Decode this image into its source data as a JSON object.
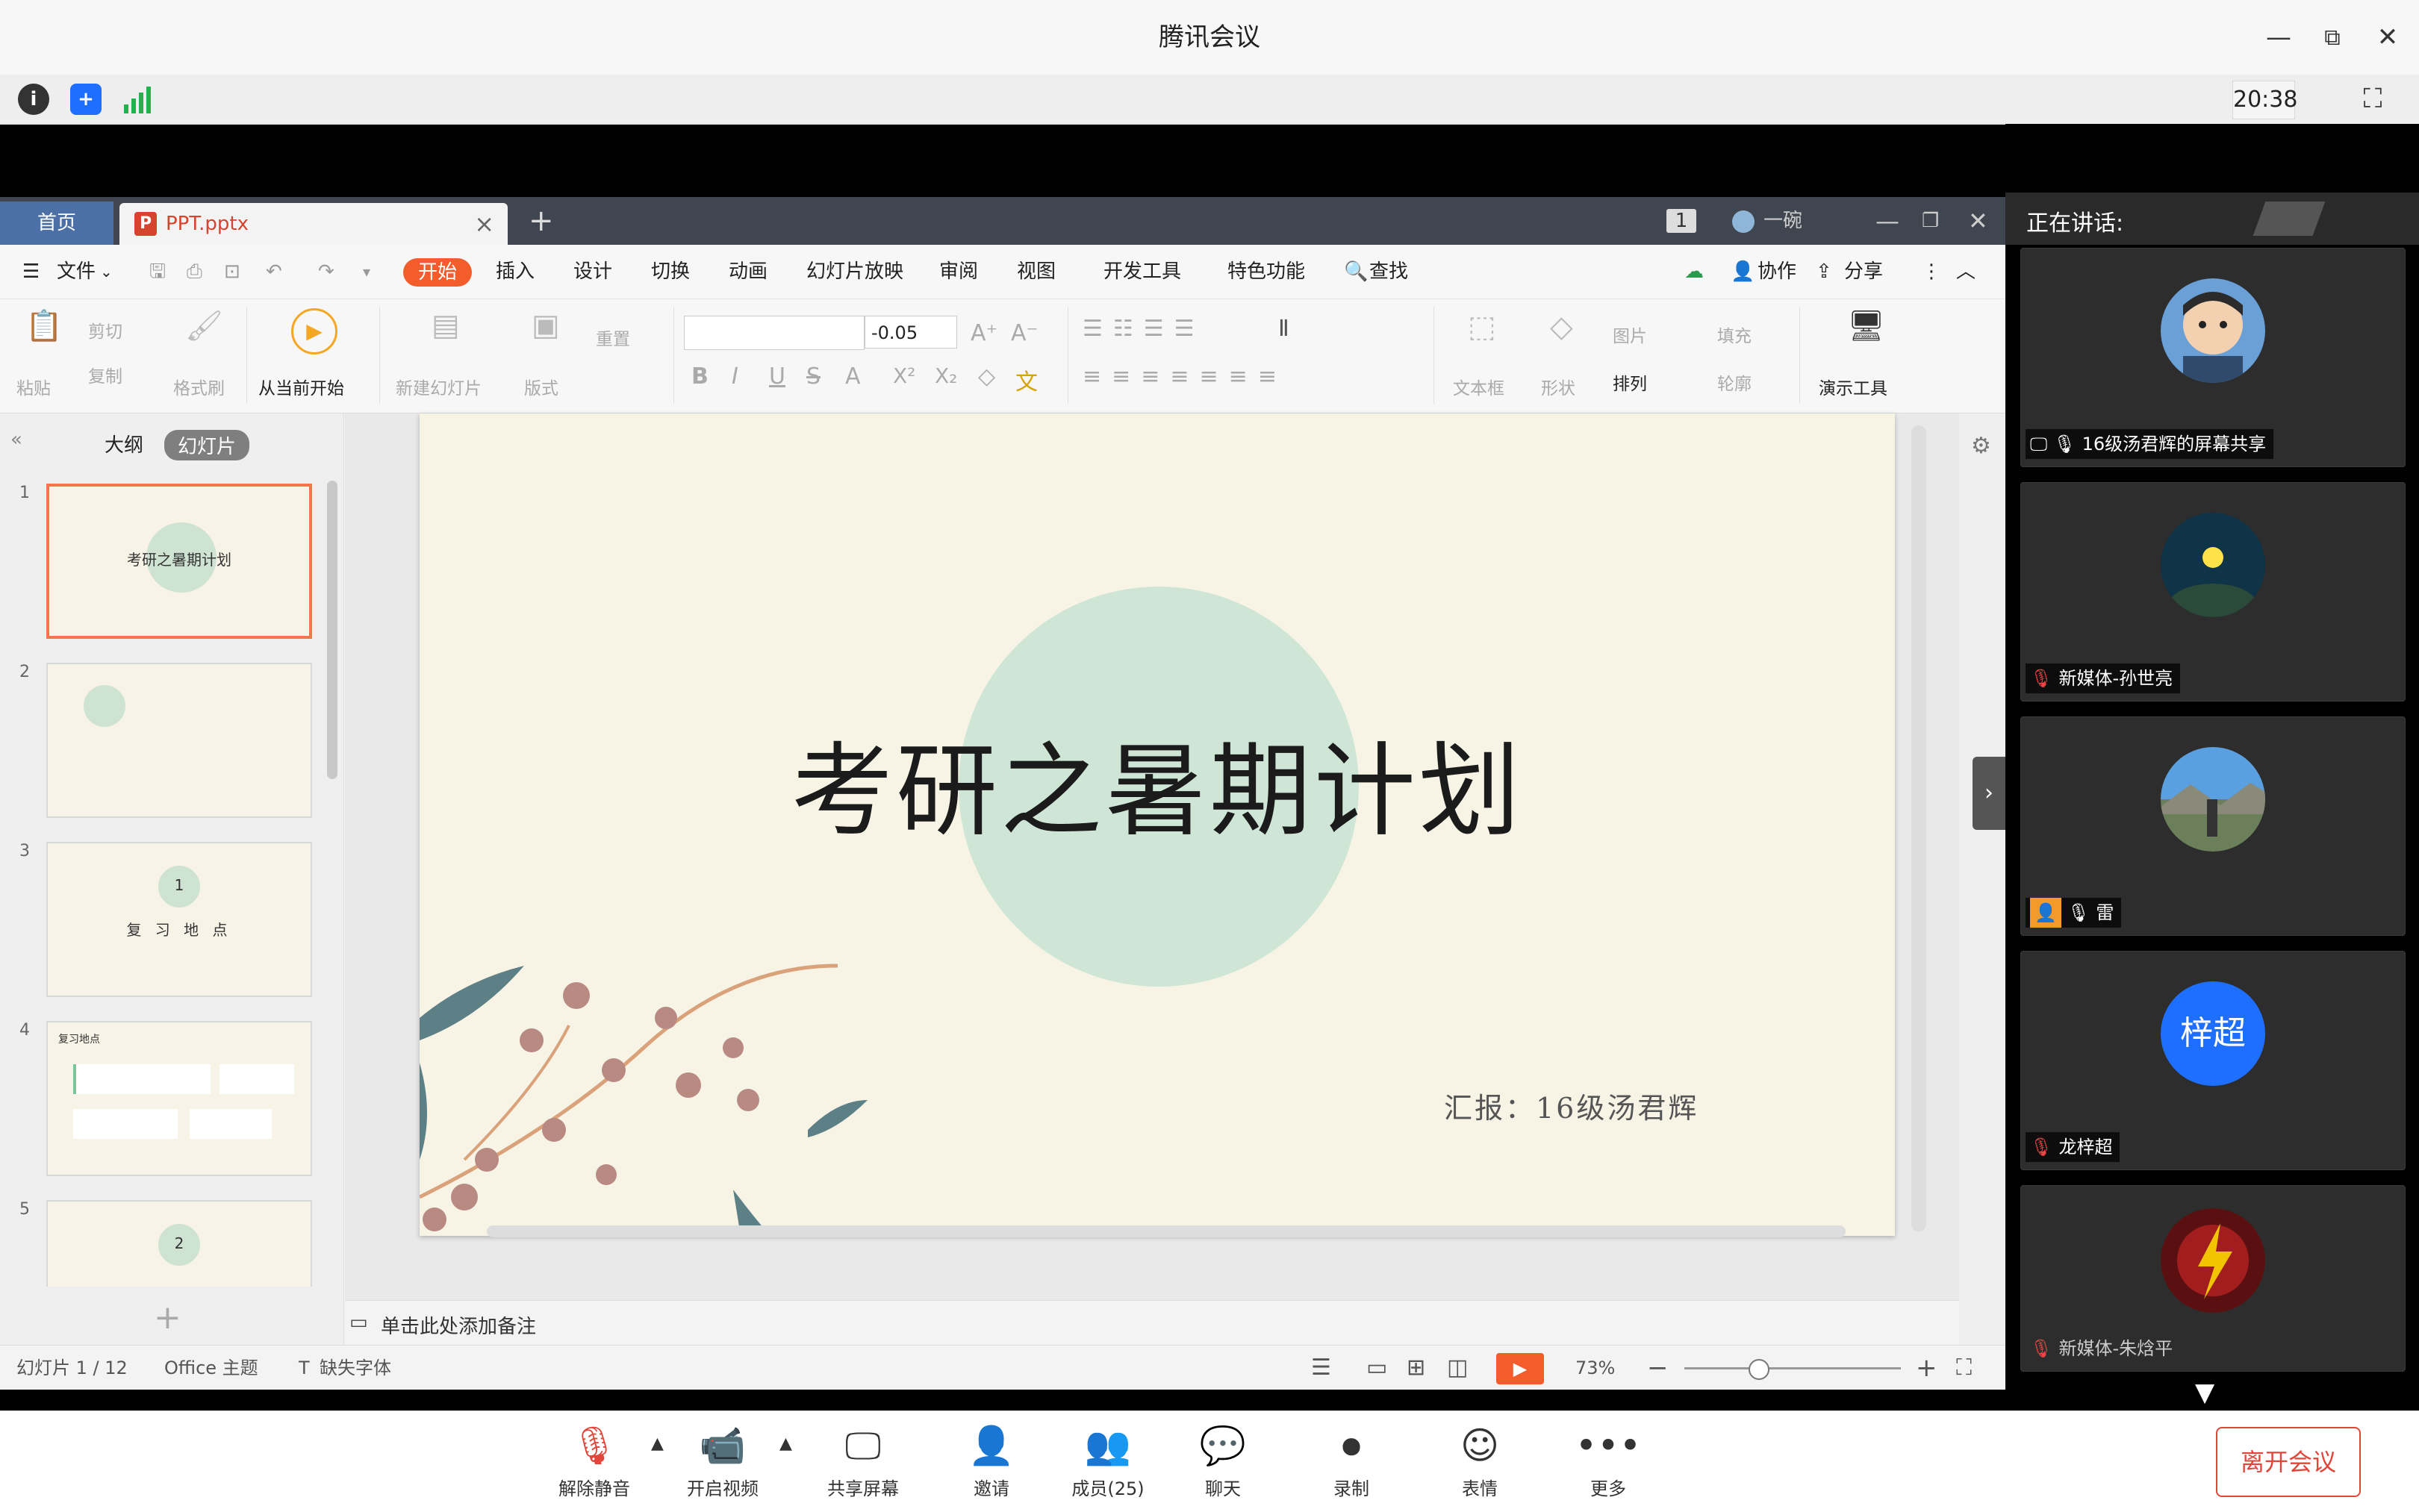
{
  "window": {
    "title": "腾讯会议",
    "clock": "20:38"
  },
  "status_icons": [
    "info-icon",
    "shield-icon",
    "signal-icon"
  ],
  "wps": {
    "tabs": {
      "home": "首页",
      "file": "PPT.pptx",
      "add": "+",
      "user": "一碗",
      "badge": "1"
    },
    "menu": {
      "file": "文件",
      "items": [
        "开始",
        "插入",
        "设计",
        "切换",
        "动画",
        "幻灯片放映",
        "审阅",
        "视图",
        "开发工具",
        "特色功能"
      ],
      "search": "查找",
      "collab": "协作",
      "share": "分享"
    },
    "ribbon": {
      "paste": "粘贴",
      "cut": "剪切",
      "copy": "复制",
      "format_painter": "格式刷",
      "from_current": "从当前开始",
      "new_slide": "新建幻灯片",
      "layout": "版式",
      "reset": "重置",
      "font_size": "-0.05",
      "textbox": "文本框",
      "shape": "形状",
      "picture": "图片",
      "fill": "填充",
      "arrange": "排列",
      "outline": "轮廓",
      "present_tools": "演示工具"
    },
    "left_panel": {
      "tab_outline": "大纲",
      "tab_slides": "幻灯片",
      "add": "+"
    },
    "thumbnails": [
      {
        "num": "1",
        "title": "考研之暑期计划"
      },
      {
        "num": "2",
        "title": ""
      },
      {
        "num": "3",
        "title": "1",
        "sub": "复 习 地 点"
      },
      {
        "num": "4",
        "title": "复习地点"
      },
      {
        "num": "5",
        "title": "2"
      }
    ],
    "slide": {
      "title": "考研之暑期计划",
      "subtitle": "汇报：16级汤君辉"
    },
    "notes_placeholder": "单击此处添加备注",
    "status": {
      "slide_count": "幻灯片 1 / 12",
      "theme": "Office 主题",
      "missing_font": "缺失字体",
      "zoom": "73%"
    }
  },
  "meeting": {
    "speaking_label": "正在讲话:",
    "speakers": [
      {
        "name": "16级汤君辉的屏幕共享",
        "avatar": "cartoon-avatar"
      },
      {
        "name": "新媒体-孙世亮",
        "avatar": "night-avatar"
      },
      {
        "name": "雷",
        "avatar": "mountain-avatar"
      },
      {
        "name": "龙梓超",
        "avatar_text": "梓超"
      },
      {
        "name": "新媒体-朱焓平",
        "avatar": "flash-avatar"
      }
    ],
    "toolbar": {
      "unmute": "解除静音",
      "start_video": "开启视频",
      "share_screen": "共享屏幕",
      "invite": "邀请",
      "members": "成员(25)",
      "chat": "聊天",
      "record": "录制",
      "emoji": "表情",
      "more": "更多",
      "leave": "离开会议"
    },
    "colors": {
      "accent": "#f25d2b",
      "leave": "#e0473a",
      "avatar_blue": "#1e6fff"
    }
  }
}
